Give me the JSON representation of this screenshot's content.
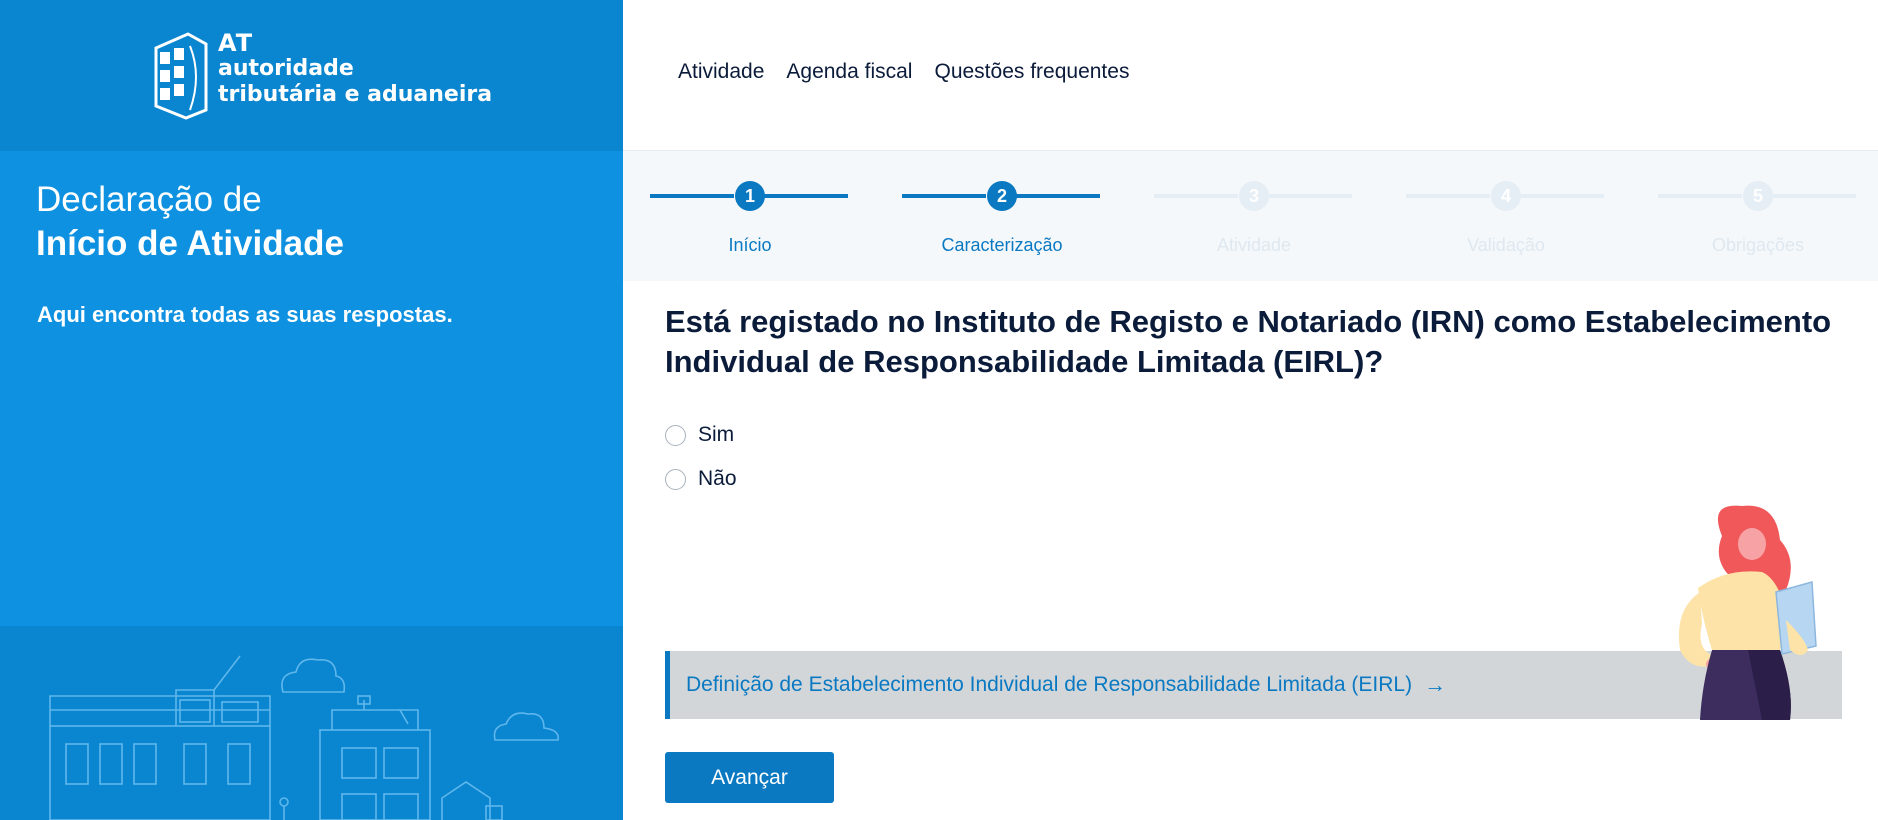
{
  "brand": {
    "abbr": "AT",
    "line1": "autoridade",
    "line2": "tributária e aduaneira"
  },
  "sidebar": {
    "title_line1": "Declaração de",
    "title_line2": "Início de Atividade",
    "subtitle": "Aqui encontra todas as suas respostas."
  },
  "nav": {
    "items": [
      "Atividade",
      "Agenda fiscal",
      "Questões frequentes"
    ]
  },
  "stepper": {
    "steps": [
      {
        "number": "1",
        "label": "Início",
        "active": true
      },
      {
        "number": "2",
        "label": "Caracterização",
        "active": true
      },
      {
        "number": "3",
        "label": "Atividade",
        "active": false
      },
      {
        "number": "4",
        "label": "Validação",
        "active": false
      },
      {
        "number": "5",
        "label": "Obrigações",
        "active": false
      }
    ]
  },
  "question": {
    "text": "Está registado no Instituto de Registo e Notariado (IRN) como Estabelecimento Individual de Responsabilidade Limitada (EIRL)?",
    "options": [
      "Sim",
      "Não"
    ]
  },
  "info": {
    "link_text": "Definição de Estabelecimento Individual de Responsabilidade Limitada (EIRL)"
  },
  "actions": {
    "advance_label": "Avançar"
  },
  "colors": {
    "primary": "#0a79c2",
    "sidebar": "#0d91e0",
    "sidebar_dark": "#0a85cf",
    "text": "#0b1b3a"
  }
}
